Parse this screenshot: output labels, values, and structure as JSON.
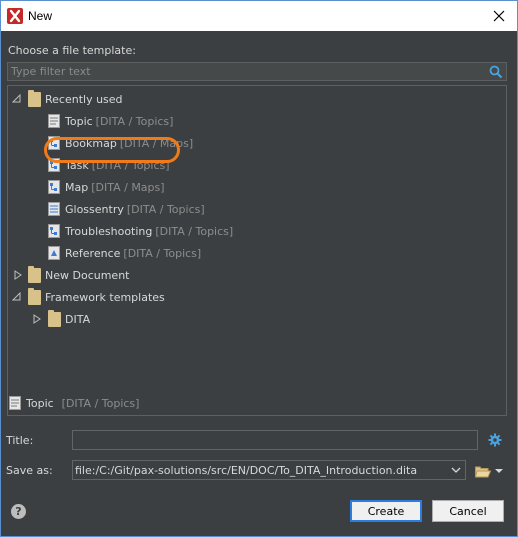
{
  "window": {
    "title": "New"
  },
  "choose_label": "Choose a file template:",
  "filter": {
    "placeholder": "Type filter text",
    "value": ""
  },
  "tree": {
    "recently_used": "Recently used",
    "recent_items": [
      {
        "label": "Topic",
        "category": "[DITA / Topics]"
      },
      {
        "label": "Bookmap",
        "category": "[DITA / Maps]"
      },
      {
        "label": "Task",
        "category": "[DITA / Topics]"
      },
      {
        "label": "Map",
        "category": "[DITA / Maps]"
      },
      {
        "label": "Glossentry",
        "category": "[DITA / Topics]"
      },
      {
        "label": "Troubleshooting",
        "category": "[DITA / Topics]"
      },
      {
        "label": "Reference",
        "category": "[DITA / Topics]"
      }
    ],
    "new_document": "New Document",
    "framework_templates": "Framework templates",
    "dita": "DITA"
  },
  "selected": {
    "label": "Topic",
    "category": "[DITA / Topics]"
  },
  "form": {
    "title_label": "Title:",
    "title_value": "",
    "saveas_label": "Save as:",
    "saveas_value": "file:/C:/Git/pax-solutions/src/EN/DOC/To_DITA_Introduction.dita"
  },
  "buttons": {
    "create": "Create",
    "cancel": "Cancel"
  },
  "help": "?",
  "colors": {
    "highlight_ring": "#f07b18",
    "primary_border": "#2b7de0",
    "folder": "#d9c28a"
  }
}
